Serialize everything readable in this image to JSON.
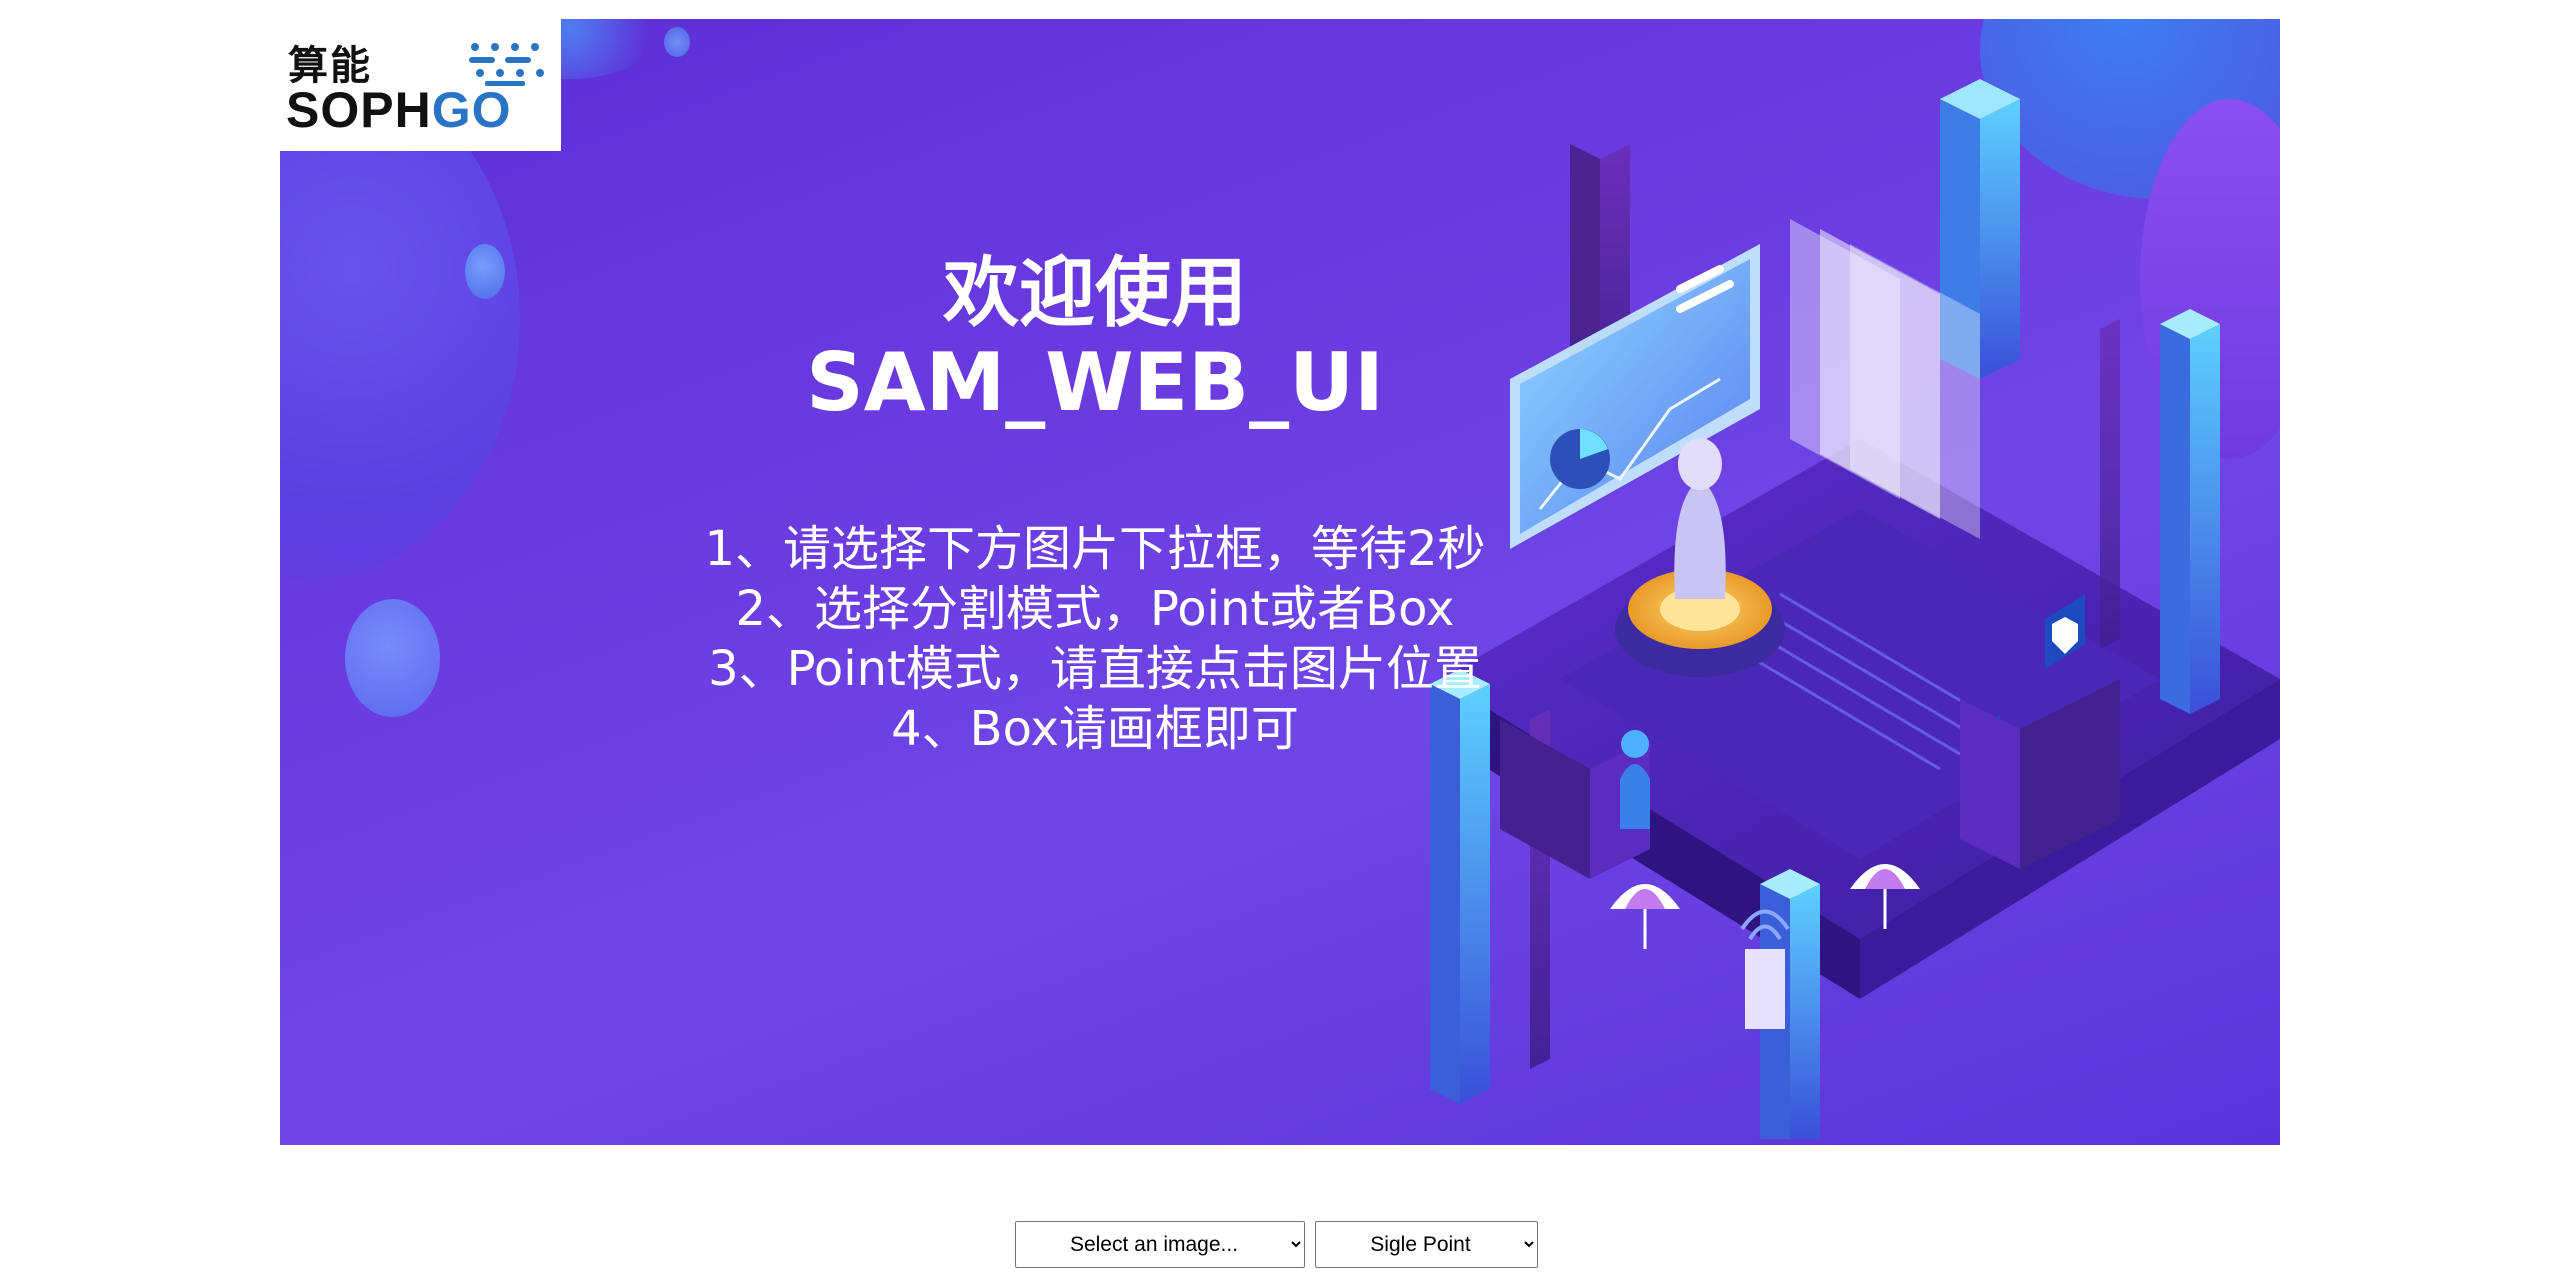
{
  "logo": {
    "chinese_text": "算能",
    "brand_prefix": "SOPH",
    "brand_suffix": "GO"
  },
  "hero": {
    "title": "欢迎使用",
    "subtitle": "SAM_WEB_UI",
    "steps": [
      "1、请选择下方图片下拉框，等待2秒",
      "2、选择分割模式，Point或者Box",
      "3、Point模式，请直接点击图片位置",
      "4、Box请画框即可"
    ]
  },
  "controls": {
    "image_select": {
      "selected": "Select an image..."
    },
    "mode_select": {
      "selected": "Sigle Point"
    }
  },
  "colors": {
    "banner_start": "#5b2fd6",
    "banner_end": "#6f46e6",
    "logo_accent": "#2a74c4"
  }
}
